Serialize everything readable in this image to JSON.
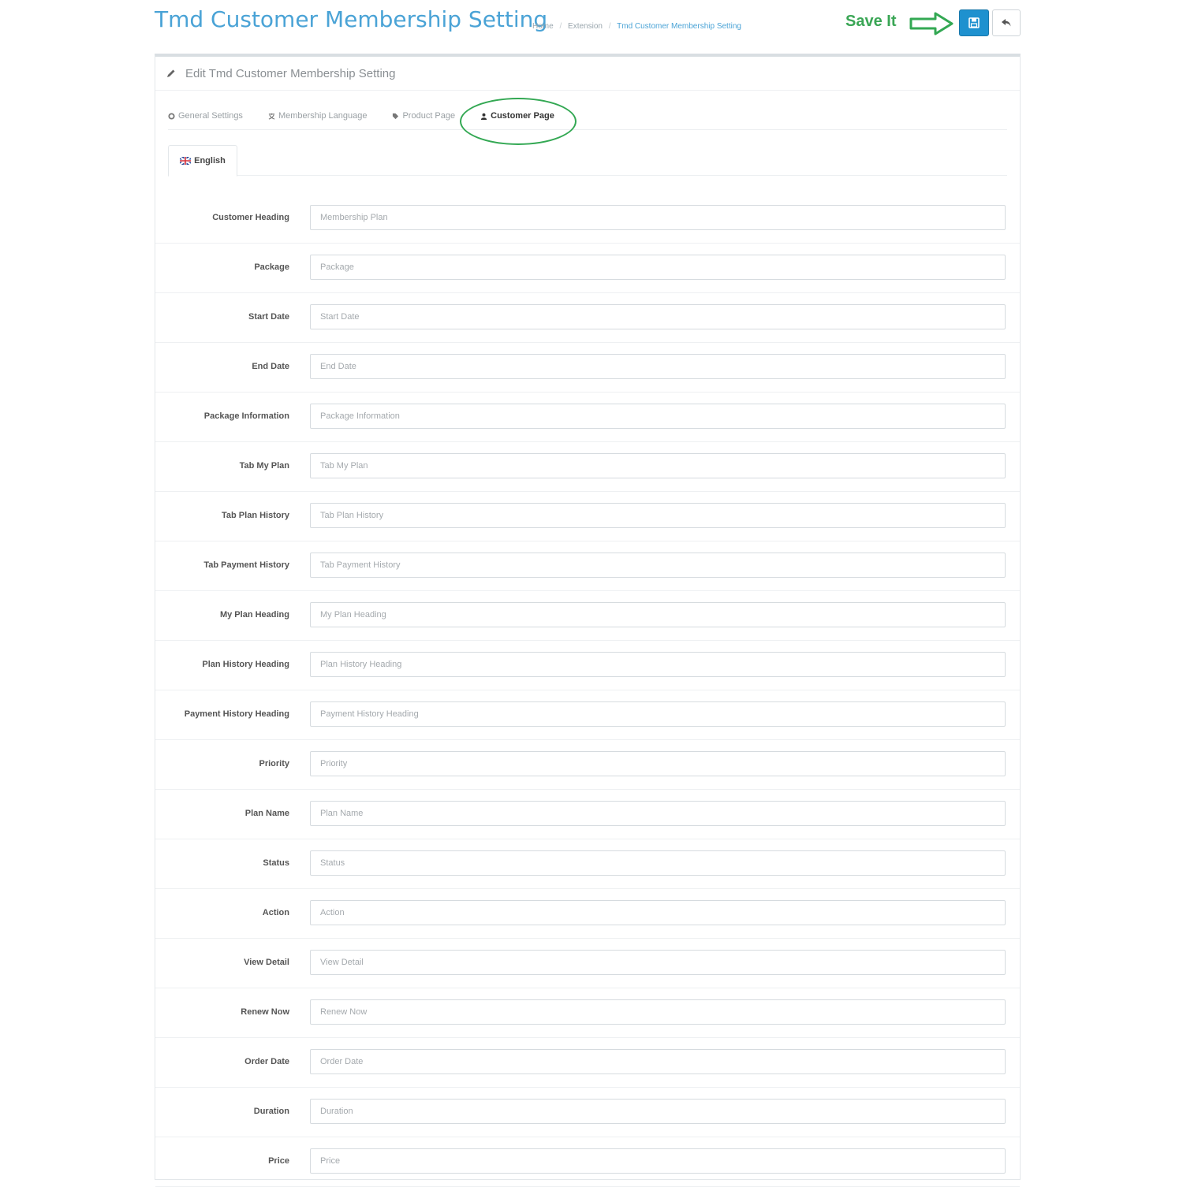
{
  "header": {
    "title": "Tmd Customer Membership Setting",
    "breadcrumb": [
      "Home",
      "Extension",
      "Tmd Customer Membership Setting"
    ],
    "save_callout": "Save It"
  },
  "panel": {
    "heading": "Edit Tmd Customer Membership Setting"
  },
  "tabs": [
    {
      "label": "General Settings",
      "icon": "gear-icon"
    },
    {
      "label": "Membership Language",
      "icon": "language-icon"
    },
    {
      "label": "Product Page",
      "icon": "tag-icon"
    },
    {
      "label": "Customer Page",
      "icon": "user-icon",
      "active": true
    }
  ],
  "language_tab": {
    "label": "English",
    "icon": "flag-uk-icon"
  },
  "fields": [
    {
      "label": "Customer Heading",
      "placeholder": "Membership Plan"
    },
    {
      "label": "Package",
      "placeholder": "Package"
    },
    {
      "label": "Start Date",
      "placeholder": "Start Date"
    },
    {
      "label": "End Date",
      "placeholder": "End Date"
    },
    {
      "label": "Package Information",
      "placeholder": "Package Information"
    },
    {
      "label": "Tab My Plan",
      "placeholder": "Tab My Plan"
    },
    {
      "label": "Tab Plan History",
      "placeholder": "Tab Plan History"
    },
    {
      "label": "Tab Payment History",
      "placeholder": "Tab Payment History"
    },
    {
      "label": "My Plan Heading",
      "placeholder": "My Plan Heading"
    },
    {
      "label": "Plan History Heading",
      "placeholder": "Plan History Heading"
    },
    {
      "label": "Payment History Heading",
      "placeholder": "Payment History Heading"
    },
    {
      "label": "Priority",
      "placeholder": "Priority"
    },
    {
      "label": "Plan Name",
      "placeholder": "Plan Name"
    },
    {
      "label": "Status",
      "placeholder": "Status"
    },
    {
      "label": "Action",
      "placeholder": "Action"
    },
    {
      "label": "View Detail",
      "placeholder": "View Detail"
    },
    {
      "label": "Renew Now",
      "placeholder": "Renew Now"
    },
    {
      "label": "Order Date",
      "placeholder": "Order Date"
    },
    {
      "label": "Duration",
      "placeholder": "Duration"
    },
    {
      "label": "Price",
      "placeholder": "Price"
    }
  ],
  "colors": {
    "accent": "#1e91cf",
    "title": "#4aa3d6",
    "callout": "#33a853"
  }
}
